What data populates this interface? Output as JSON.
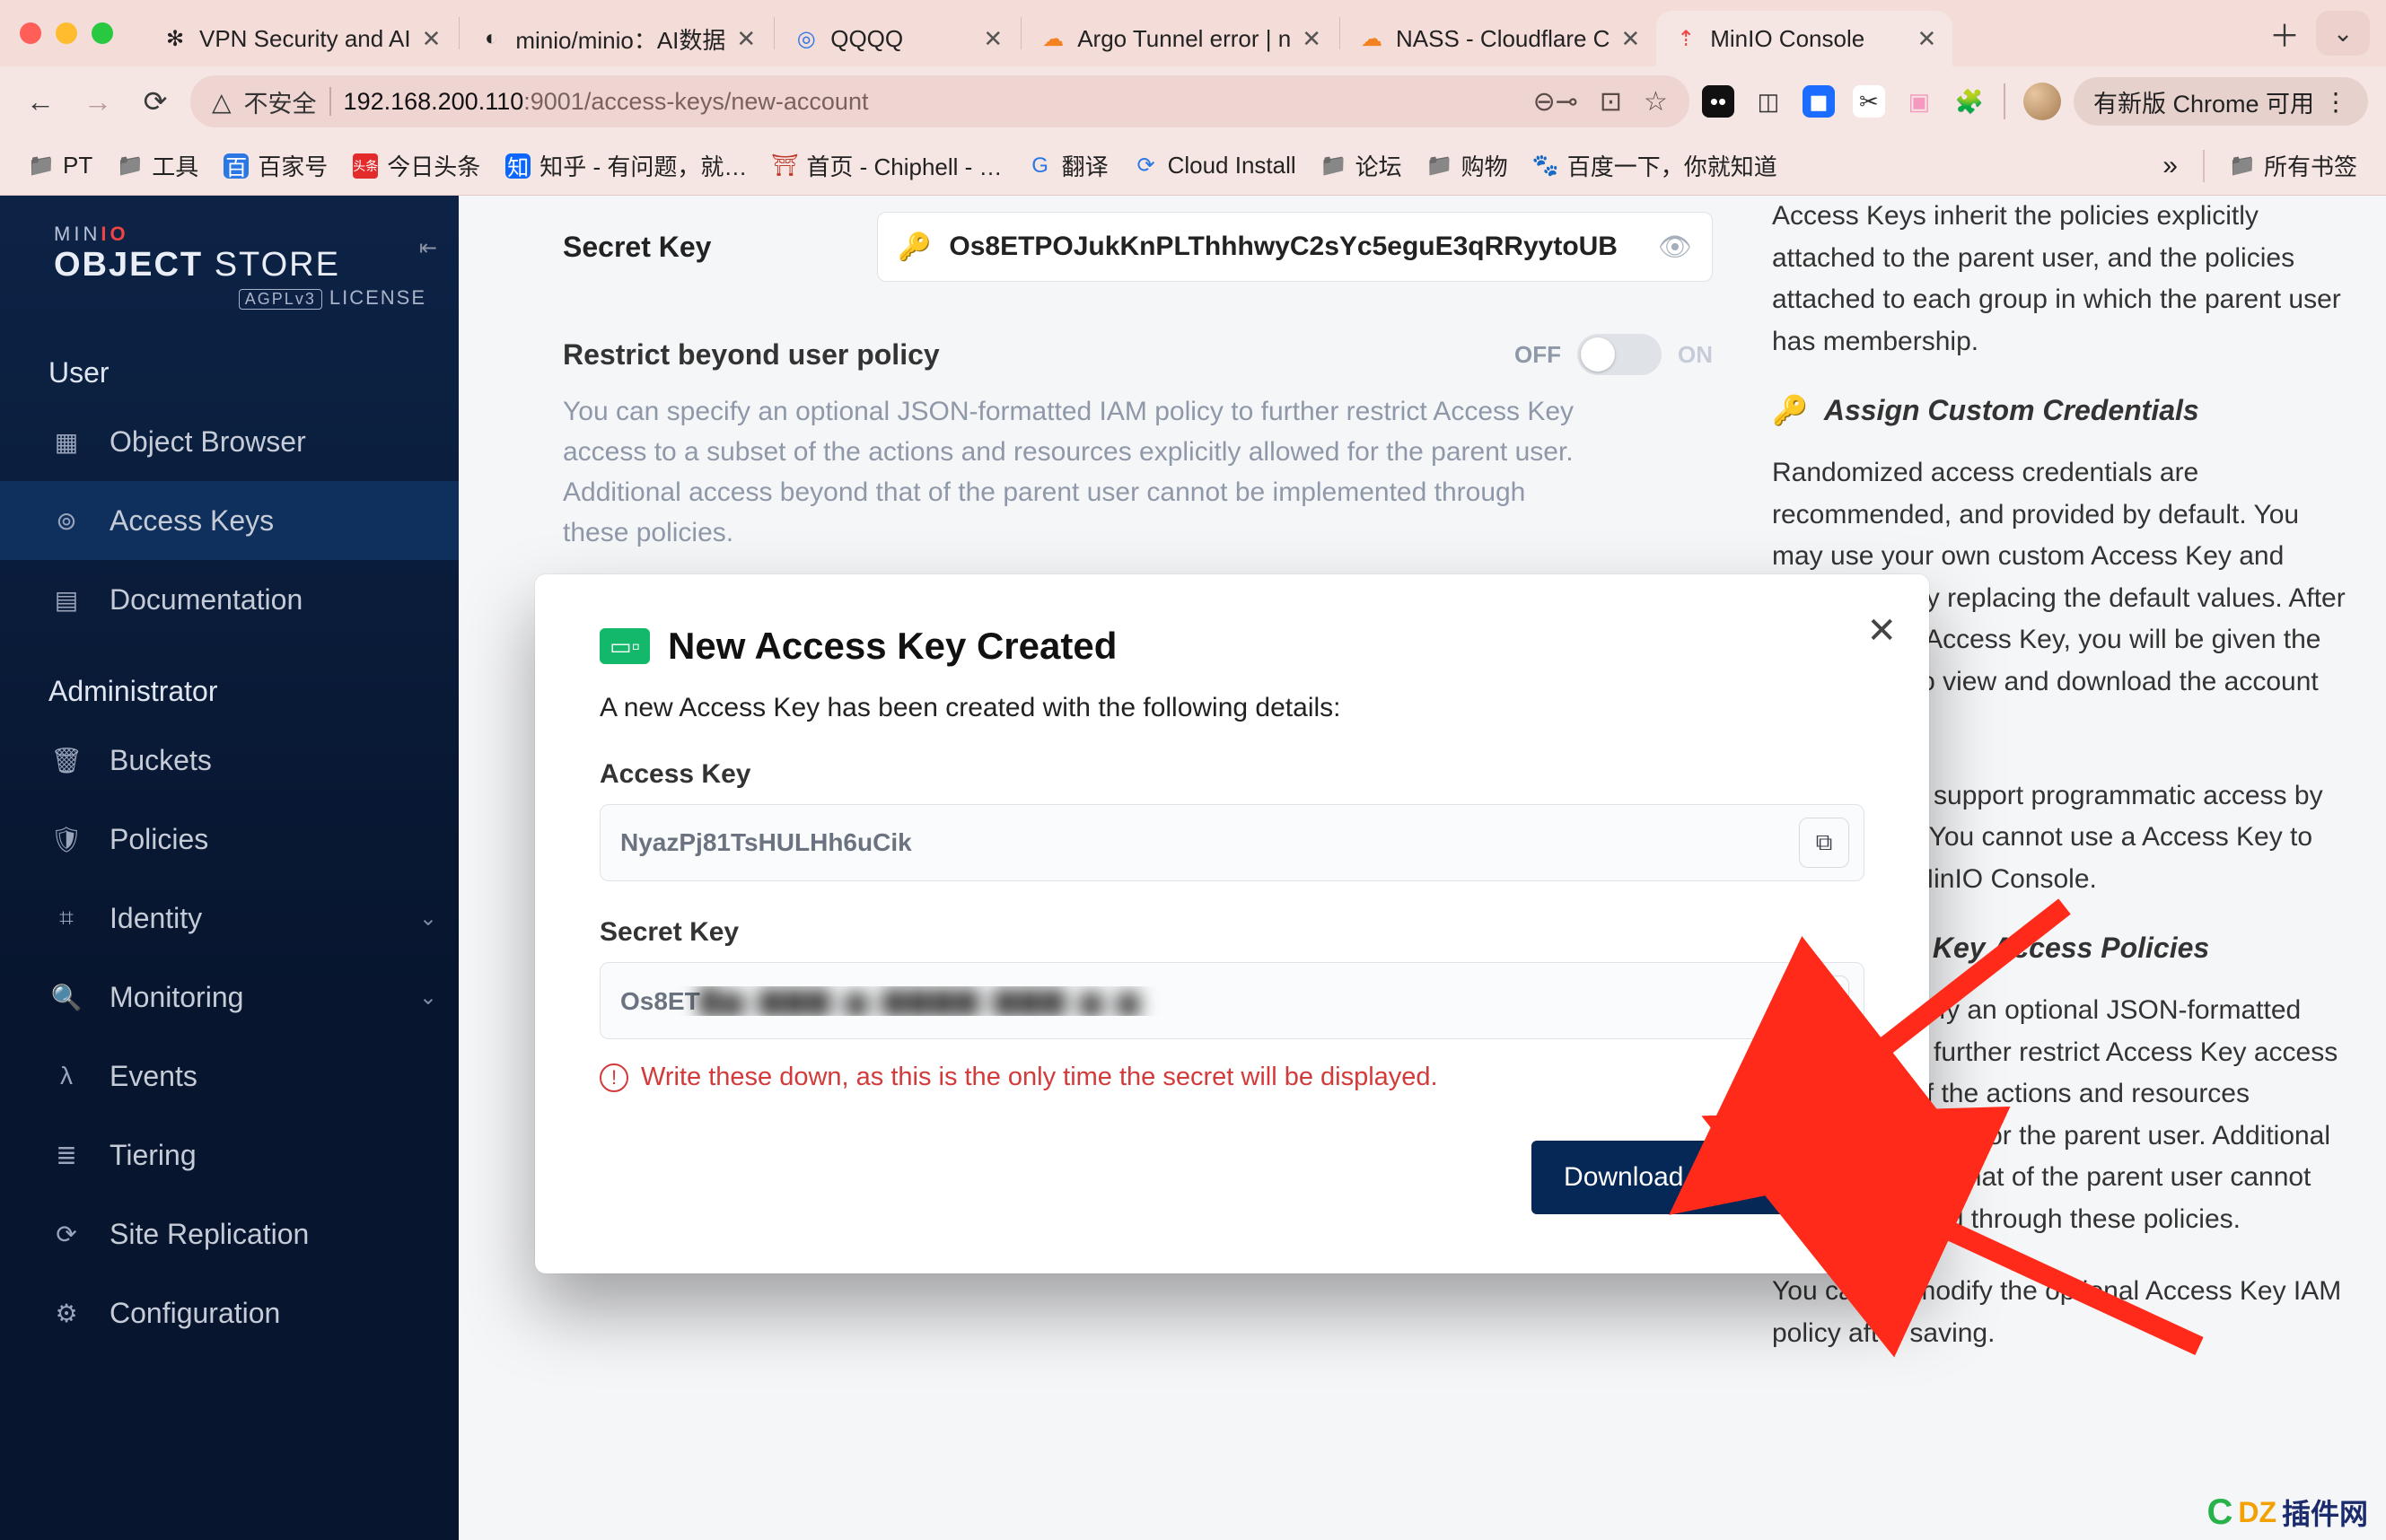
{
  "browser": {
    "tabs": [
      {
        "title": "VPN Security and AI",
        "favicon": "✻"
      },
      {
        "title": "minio/minio：AI数据",
        "favicon": "◐"
      },
      {
        "title": "QQQQ",
        "favicon": "◎"
      },
      {
        "title": "Argo Tunnel error | n",
        "favicon": "☁"
      },
      {
        "title": "NASS - Cloudflare C",
        "favicon": "☁"
      },
      {
        "title": "MinIO Console",
        "favicon": "⇡",
        "active": true
      }
    ],
    "url": {
      "security_label": "不安全",
      "host_ip": "192.168.200.110",
      "port": ":9001",
      "path": "/access-keys/new-account"
    },
    "update_pill": "有新版 Chrome 可用",
    "bookmarks": [
      {
        "label": "PT",
        "type": "folder"
      },
      {
        "label": "工具",
        "type": "folder"
      },
      {
        "label": "百家号",
        "icon": "百"
      },
      {
        "label": "今日头条",
        "icon": "头条"
      },
      {
        "label": "知乎 - 有问题，就…",
        "icon": "知"
      },
      {
        "label": "首页 - Chiphell - …",
        "icon": "⛩"
      },
      {
        "label": "翻译",
        "icon": "G"
      },
      {
        "label": "Cloud Install",
        "icon": "⟳"
      },
      {
        "label": "论坛",
        "type": "folder"
      },
      {
        "label": "购物",
        "type": "folder"
      },
      {
        "label": "百度一下，你就知道",
        "icon": "🐾"
      }
    ],
    "all_bookmarks": "所有书签"
  },
  "sidebar": {
    "brand": {
      "line1_pre": "MIN",
      "line1_accent": "IO",
      "line2a": "OBJECT",
      "line2b": " STORE",
      "license_badge": "AGPLv3",
      "license": "LICENSE"
    },
    "sections": [
      {
        "title": "User",
        "items": [
          {
            "label": "Object Browser",
            "icon": "▦"
          },
          {
            "label": "Access Keys",
            "icon": "⊚",
            "active": true
          },
          {
            "label": "Documentation",
            "icon": "▤"
          }
        ]
      },
      {
        "title": "Administrator",
        "items": [
          {
            "label": "Buckets",
            "icon": "🗑"
          },
          {
            "label": "Policies",
            "icon": "🛡"
          },
          {
            "label": "Identity",
            "icon": "⌗",
            "expandable": true
          },
          {
            "label": "Monitoring",
            "icon": "🔍",
            "expandable": true
          },
          {
            "label": "Events",
            "icon": "λ"
          },
          {
            "label": "Tiering",
            "icon": "≣"
          },
          {
            "label": "Site Replication",
            "icon": "⟳"
          },
          {
            "label": "Configuration",
            "icon": "⚙"
          }
        ]
      }
    ]
  },
  "page": {
    "secret_key_label": "Secret Key",
    "secret_key_value": "Os8ETPOJukKnPLThhhwyC2sYc5eguE3qRRyytoUB",
    "restrict_label": "Restrict beyond user policy",
    "toggle_off": "OFF",
    "toggle_on": "ON",
    "restrict_help": "You can specify an optional JSON-formatted IAM policy to further restrict Access Key access to a subset of the actions and resources explicitly allowed for the parent user. Additional access beyond that of the parent user cannot be implemented through these policies."
  },
  "right": {
    "p1": "Access Keys inherit the policies explicitly attached to the parent user, and the policies attached to each group in which the parent user has membership.",
    "h1": "Assign Custom Credentials",
    "p2": "Randomized access credentials are recommended, and provided by default. You may use your own custom Access Key and Secret Key by replacing the default values. After creating any Access Key, you will be given the opportunity to view and download the account credentials.",
    "p3": "Access Keys support programmatic access by applications. You cannot use a Access Key to log into the MinIO Console.",
    "h2": "Access Key Access Policies",
    "p4": "You can specify an optional JSON-formatted IAM policy to further restrict Access Key access to a subset of the actions and resources explicitly allowed for the parent user. Additional access beyond that of the parent user cannot be implemented through these policies.",
    "p5": "You cannot modify the optional Access Key IAM policy after saving."
  },
  "modal": {
    "title": "New Access Key Created",
    "subtitle": "A new Access Key has been created with the following details:",
    "access_key_label": "Access Key",
    "access_key_value": "NyazPj81TsHULHh6uCik",
    "secret_key_label": "Secret Key",
    "secret_key_prefix": "Os8ET",
    "secret_key_hidden": "█▆  ▇▇▇ ▆ ▇▇▇▇  ▇▇▇  ▆ ▆",
    "warning": "Write these down, as this is the only time the secret will be displayed.",
    "download_label": "Download for import"
  },
  "watermark": {
    "rest": "插件网"
  }
}
